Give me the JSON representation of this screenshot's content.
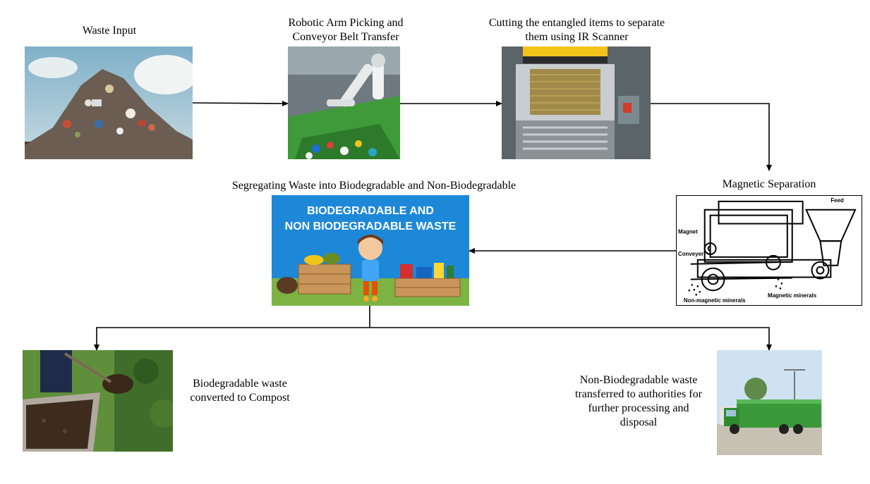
{
  "steps": {
    "waste_input": "Waste Input",
    "robotic_arm": {
      "line1": "Robotic Arm Picking and",
      "line2": "Conveyor Belt Transfer"
    },
    "cutting": {
      "line1": "Cutting the entangled items to separate",
      "line2": "them using IR Scanner"
    },
    "magnetic": "Magnetic Separation",
    "segregating": "Segregating Waste into Biodegradable and Non-Biodegradable",
    "compost": {
      "line1": "Biodegradable waste",
      "line2": "converted to Compost"
    },
    "non_bio": {
      "line1": "Non-Biodegradable waste",
      "line2": "transferred to authorities for",
      "line3": "further processing and",
      "line4": "disposal"
    }
  },
  "poster": {
    "line1": "BIODEGRADABLE AND",
    "line2": "NON BIODEGRADABLE WASTE"
  },
  "magnet_diagram": {
    "feed": "Feed",
    "magnet": "Magnet",
    "conveyer": "Conveyer",
    "non_magnetic": "Non-magnetic minerals",
    "magnetic_minerals": "Magnetic minerals"
  },
  "colors": {
    "arrow": "#000000",
    "poster_bg": "#1e88d8",
    "grass": "#7cb342",
    "truck": "#3a9a3a"
  }
}
